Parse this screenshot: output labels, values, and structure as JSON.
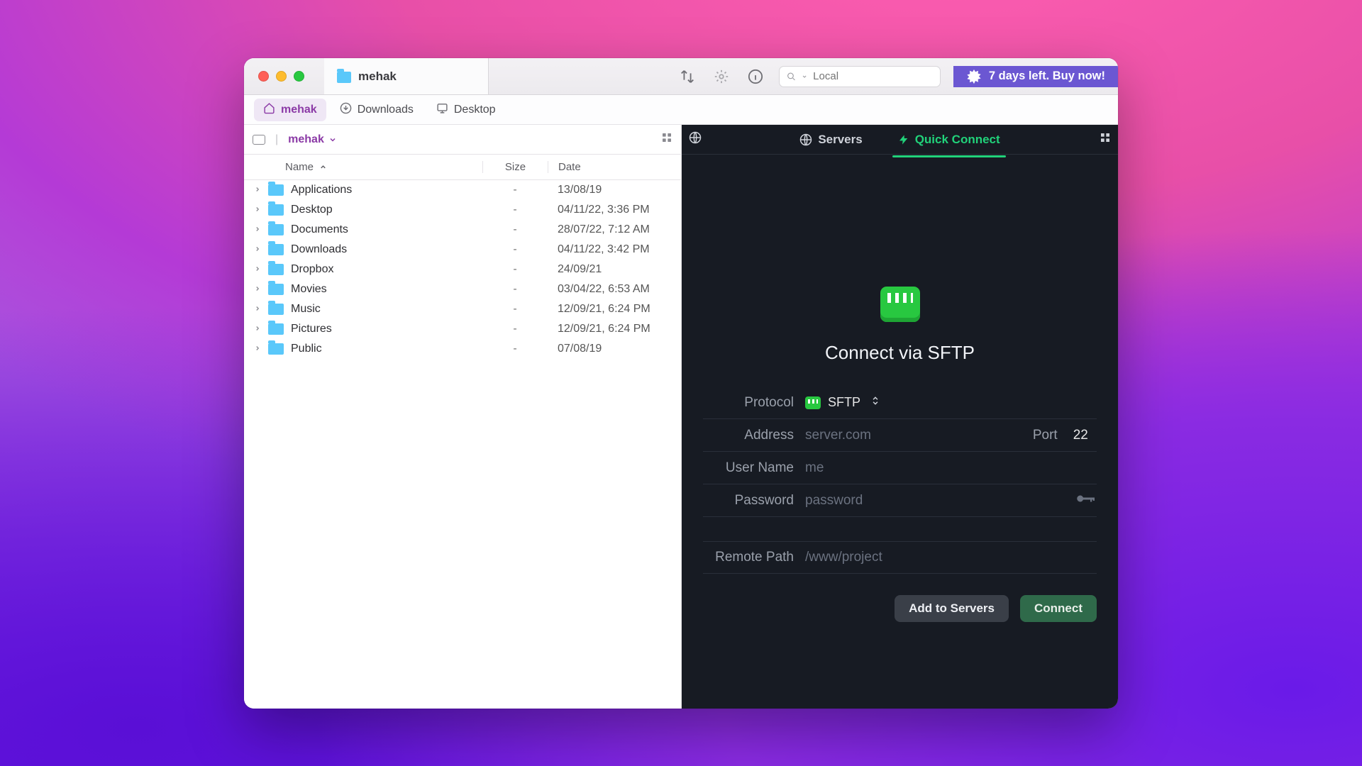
{
  "titlebar": {
    "tab_title": "mehak",
    "search_placeholder": "Local",
    "trial_text": "7 days left. Buy now!"
  },
  "subtabs": [
    {
      "label": "mehak",
      "active": true,
      "icon": "home"
    },
    {
      "label": "Downloads",
      "active": false,
      "icon": "download"
    },
    {
      "label": "Desktop",
      "active": false,
      "icon": "desktop"
    }
  ],
  "pathbar": {
    "crumb": "mehak"
  },
  "columns": {
    "name": "Name",
    "size": "Size",
    "date": "Date"
  },
  "rows": [
    {
      "name": "Applications",
      "size": "-",
      "date": "13/08/19"
    },
    {
      "name": "Desktop",
      "size": "-",
      "date": "04/11/22, 3:36 PM"
    },
    {
      "name": "Documents",
      "size": "-",
      "date": "28/07/22, 7:12 AM"
    },
    {
      "name": "Downloads",
      "size": "-",
      "date": "04/11/22, 3:42 PM"
    },
    {
      "name": "Dropbox",
      "size": "-",
      "date": "24/09/21"
    },
    {
      "name": "Movies",
      "size": "-",
      "date": "03/04/22, 6:53 AM"
    },
    {
      "name": "Music",
      "size": "-",
      "date": "12/09/21, 6:24 PM"
    },
    {
      "name": "Pictures",
      "size": "-",
      "date": "12/09/21, 6:24 PM"
    },
    {
      "name": "Public",
      "size": "-",
      "date": "07/08/19"
    }
  ],
  "remote": {
    "tabs": {
      "servers": "Servers",
      "quick": "Quick Connect"
    },
    "title": "Connect via SFTP",
    "labels": {
      "protocol": "Protocol",
      "address": "Address",
      "port": "Port",
      "user": "User Name",
      "password": "Password",
      "remote_path": "Remote Path"
    },
    "values": {
      "protocol": "SFTP",
      "address_ph": "server.com",
      "port": "22",
      "user_ph": "me",
      "password_ph": "password",
      "remote_path_ph": "/www/project"
    },
    "buttons": {
      "add": "Add to Servers",
      "connect": "Connect"
    }
  }
}
